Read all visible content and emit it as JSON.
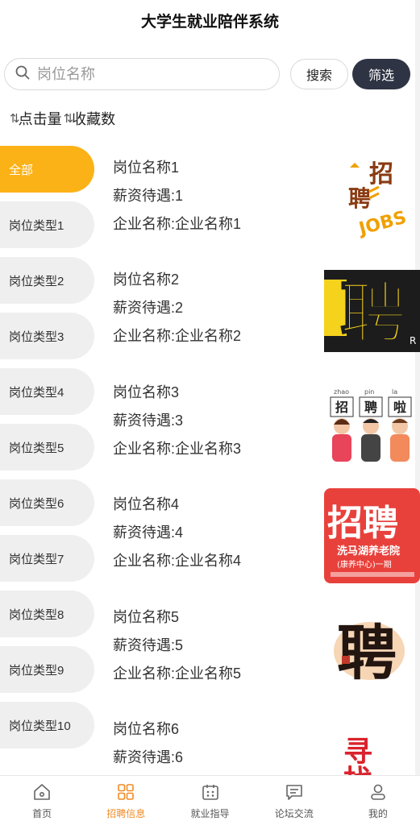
{
  "header": {
    "title": "大学生就业陪伴系统"
  },
  "search": {
    "placeholder": "岗位名称",
    "search_label": "搜索",
    "filter_label": "筛选"
  },
  "sort": {
    "clicks": "点击量",
    "favorites": "收藏数"
  },
  "categories": [
    "全部",
    "岗位类型1",
    "岗位类型2",
    "岗位类型3",
    "岗位类型4",
    "岗位类型5",
    "岗位类型6",
    "岗位类型7",
    "岗位类型8",
    "岗位类型9",
    "岗位类型10"
  ],
  "jobs": [
    {
      "name": "岗位名称1",
      "salary": "薪资待遇:1",
      "company": "企业名称:企业名称1",
      "poster_text": "招聘JOBS"
    },
    {
      "name": "岗位名称2",
      "salary": "薪资待遇:2",
      "company": "企业名称:企业名称2",
      "poster_text": "聘"
    },
    {
      "name": "岗位名称3",
      "salary": "薪资待遇:3",
      "company": "企业名称:企业名称3",
      "poster_text": "招聘啦"
    },
    {
      "name": "岗位名称4",
      "salary": "薪资待遇:4",
      "company": "企业名称:企业名称4",
      "poster_text": "招聘 洗马湖养老院 (康养中心)一期"
    },
    {
      "name": "岗位名称5",
      "salary": "薪资待遇:5",
      "company": "企业名称:企业名称5",
      "poster_text": "聘"
    },
    {
      "name": "岗位名称6",
      "salary": "薪资待遇:6",
      "company": "",
      "poster_text": "寻找"
    }
  ],
  "tabbar": {
    "home": "首页",
    "recruit": "招聘信息",
    "guide": "就业指导",
    "forum": "论坛交流",
    "mine": "我的"
  },
  "colors": {
    "accent": "#fbb217",
    "dark_button": "#2f3444",
    "tab_active": "#f08a24"
  }
}
